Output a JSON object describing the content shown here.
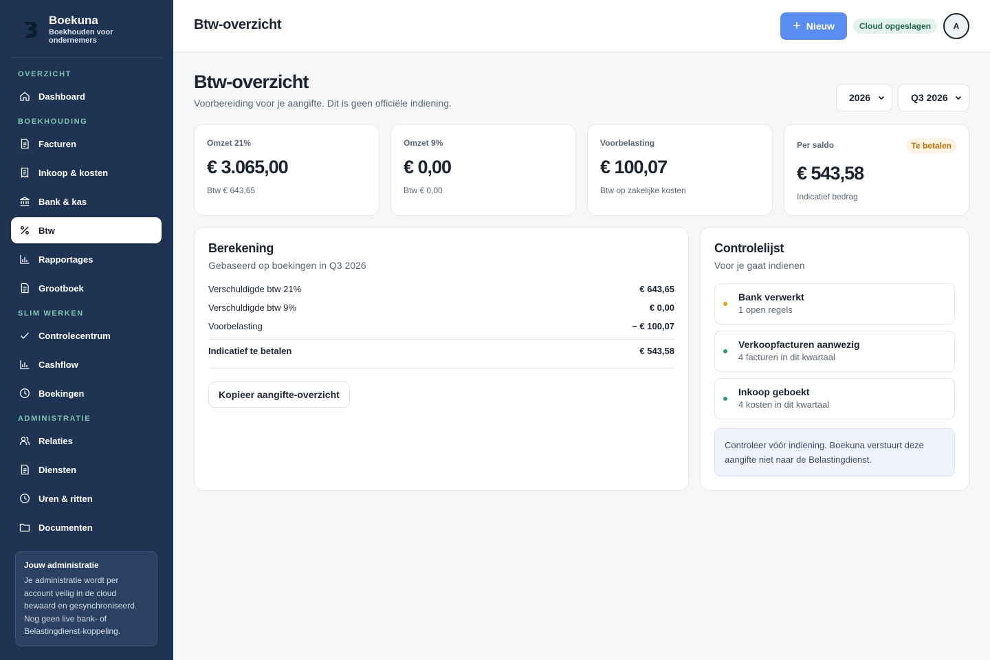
{
  "brand": {
    "name": "Boekuna",
    "subtitle": "Boekhouden voor ondernemers"
  },
  "nav": {
    "sections": {
      "overzicht": "OVERZICHT",
      "boekhouding": "BOEKHOUDING",
      "slim": "SLIM WERKEN",
      "administratie": "ADMINISTRATIE"
    },
    "items": [
      {
        "label": "Dashboard",
        "icon": "home-icon"
      },
      {
        "label": "Facturen",
        "icon": "document-icon"
      },
      {
        "label": "Inkoop & kosten",
        "icon": "receipt-icon"
      },
      {
        "label": "Bank & kas",
        "icon": "bank-icon"
      },
      {
        "label": "Btw",
        "icon": "percent-icon",
        "active": true
      },
      {
        "label": "Rapportages",
        "icon": "bar-chart-icon"
      },
      {
        "label": "Grootboek",
        "icon": "ledger-icon"
      },
      {
        "label": "Controlecentrum",
        "icon": "check-icon"
      },
      {
        "label": "Cashflow",
        "icon": "bar-chart-icon"
      },
      {
        "label": "Boekingen",
        "icon": "clock-icon"
      },
      {
        "label": "Relaties",
        "icon": "users-icon"
      },
      {
        "label": "Diensten",
        "icon": "document-icon"
      },
      {
        "label": "Uren & ritten",
        "icon": "clock-icon"
      },
      {
        "label": "Documenten",
        "icon": "folder-icon"
      }
    ]
  },
  "admin_card": {
    "title": "Jouw administratie",
    "text": "Je administratie wordt per account veilig in de cloud bewaard en gesynchroniseerd. Nog geen live bank- of Belastingdienst-koppeling."
  },
  "topbar": {
    "title": "Btw-overzicht",
    "new_label": "Nieuw",
    "cloud_status": "Cloud opgeslagen",
    "avatar_initial": "A"
  },
  "page": {
    "title": "Btw-overzicht",
    "subtitle": "Voorbereiding voor je aangifte. Dit is geen officiële indiening.",
    "year": "2026",
    "quarter": "Q3 2026"
  },
  "stats": [
    {
      "label": "Omzet 21%",
      "value": "€ 3.065,00",
      "sub": "Btw € 643,65"
    },
    {
      "label": "Omzet 9%",
      "value": "€ 0,00",
      "sub": "Btw € 0,00"
    },
    {
      "label": "Voorbelasting",
      "value": "€ 100,07",
      "sub": "Btw op zakelijke kosten"
    },
    {
      "label": "Per saldo",
      "value": "€ 543,58",
      "sub": "Indicatief bedrag",
      "badge": "Te betalen"
    }
  ],
  "calculation": {
    "title": "Berekening",
    "subtitle": "Gebaseerd op boekingen in Q3 2026",
    "rows": [
      {
        "label": "Verschuldigde btw 21%",
        "amount": "€ 643,65"
      },
      {
        "label": "Verschuldigde btw 9%",
        "amount": "€ 0,00"
      },
      {
        "label": "Voorbelasting",
        "amount": "− € 100,07"
      }
    ],
    "total": {
      "label": "Indicatief te betalen",
      "amount": "€ 543,58"
    },
    "copy_button": "Kopieer aangifte-overzicht"
  },
  "checklist": {
    "title": "Controlelijst",
    "subtitle": "Voor je gaat indienen",
    "items": [
      {
        "title": "Bank verwerkt",
        "desc": "1 open regels",
        "status_color": "#e0a21c"
      },
      {
        "title": "Verkoopfacturen aanwezig",
        "desc": "4 facturen in dit kwartaal",
        "status_color": "#2f9a6a"
      },
      {
        "title": "Inkoop geboekt",
        "desc": "4 kosten in dit kwartaal",
        "status_color": "#2f9a6a"
      }
    ],
    "note": "Controleer vóór indiening. Boekuna verstuurt deze aangifte niet naar de Belastingdienst."
  },
  "colors": {
    "sidebar": "#1e3452",
    "accent": "#5b8df1",
    "section_label": "#7fc4b4"
  }
}
